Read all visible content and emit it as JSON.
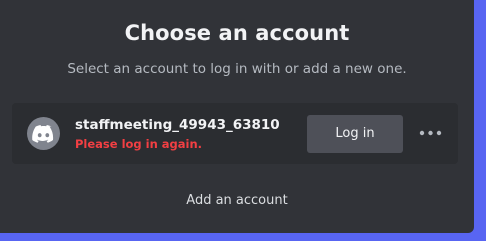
{
  "modal": {
    "title": "Choose an account",
    "subtitle": "Select an account to log in with or add a new one."
  },
  "accounts": [
    {
      "username": "staffmeeting_49943_63810",
      "status_text": "Please log in again.",
      "avatar_icon": "discord-logo-icon",
      "login_label": "Log in",
      "more_icon": "more-options-icon"
    }
  ],
  "footer": {
    "add_account_label": "Add an account"
  },
  "colors": {
    "background": "#5865f2",
    "modal": "#313338",
    "row": "#2b2d31",
    "button": "#4e5058",
    "error": "#f23f43",
    "avatar": "#80848e"
  }
}
